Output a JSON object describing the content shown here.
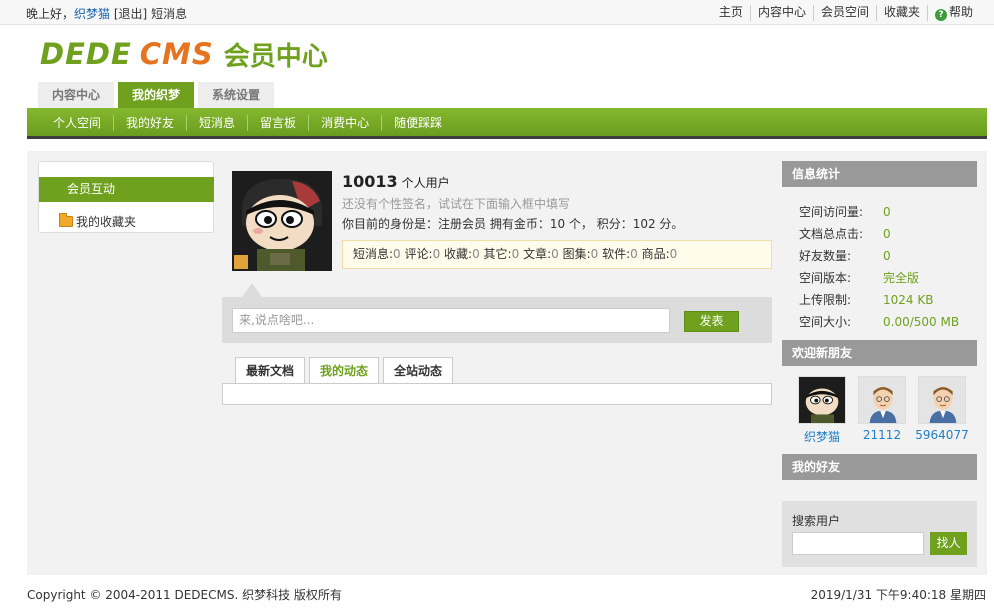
{
  "topbar": {
    "greeting": "晚上好，",
    "username": "织梦猫",
    "logout": "[退出]",
    "messages": "短消息",
    "links": [
      "主页",
      "内容中心",
      "会员空间",
      "收藏夹"
    ],
    "help": "帮助"
  },
  "logo": {
    "word1": "DEDE",
    "word2": "CMS",
    "subtitle": "会员中心"
  },
  "main_tabs": [
    "内容中心",
    "我的织梦",
    "系统设置"
  ],
  "subnav": [
    "个人空间",
    "我的好友",
    "短消息",
    "留言板",
    "消费中心",
    "随便踩踩"
  ],
  "leftnav": {
    "active": "会员互动",
    "favorites": "我的收藏夹"
  },
  "profile": {
    "id": "10013",
    "type": "个人用户",
    "signature": "还没有个性签名，试试在下面输入框中填写",
    "identity": "你目前的身份是：注册会员 拥有金币：10 个， 积分：102 分。",
    "stats": [
      {
        "label": "短消息:",
        "value": "0"
      },
      {
        "label": " 评论:",
        "value": "0"
      },
      {
        "label": " 收藏:",
        "value": "0"
      },
      {
        "label": " 其它:",
        "value": "0"
      },
      {
        "label": " 文章:",
        "value": "0"
      },
      {
        "label": " 图集:",
        "value": "0"
      },
      {
        "label": " 软件:",
        "value": "0"
      },
      {
        "label": " 商品:",
        "value": "0"
      }
    ]
  },
  "post": {
    "placeholder": "来,说点啥吧...",
    "button": "发表"
  },
  "feed_tabs": [
    "最新文档",
    "我的动态",
    "全站动态"
  ],
  "info": {
    "title": "信息统计",
    "rows": [
      {
        "k": "空间访问量:",
        "v": "0"
      },
      {
        "k": "文档总点击:",
        "v": "0"
      },
      {
        "k": "好友数量:",
        "v": "0"
      },
      {
        "k": "空间版本:",
        "v": "完全版"
      },
      {
        "k": "上传限制:",
        "v": "1024 KB"
      },
      {
        "k": "空间大小:",
        "v": "0.00/500 MB"
      }
    ]
  },
  "new_friends": {
    "title": "欢迎新朋友",
    "items": [
      "织梦猫",
      "21112",
      "5964077"
    ]
  },
  "my_friends": {
    "title": "我的好友"
  },
  "search": {
    "label": "搜索用户",
    "button": "找人"
  },
  "footer": {
    "copyright": "Copyright © 2004-2011 DEDECMS. 织梦科技 版权所有",
    "datetime": "2019/1/31 下午9:40:18 星期四"
  },
  "colors": {
    "accent": "#6fa11e",
    "title_bar": "#999999",
    "link": "#1f7fc7"
  }
}
